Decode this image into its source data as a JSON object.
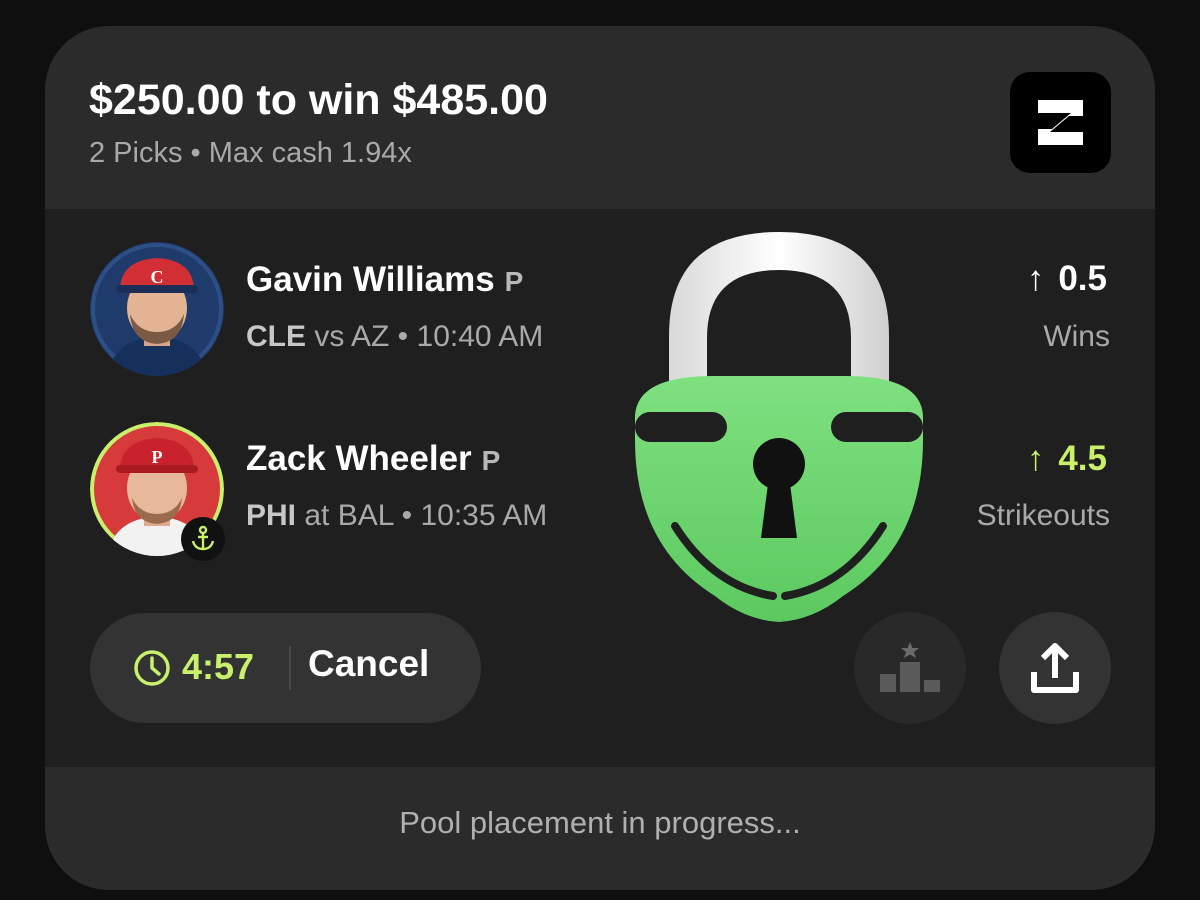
{
  "header": {
    "title": "$250.00 to win $485.00",
    "subtitle": "2 Picks • Max cash 1.94x",
    "brand_icon": "brand-logo-icon"
  },
  "picks": [
    {
      "name": "Gavin Williams",
      "position": "P",
      "team": "CLE",
      "matchup_rest": " vs AZ • 10:40 AM",
      "line": "0.5",
      "stat": "Wins",
      "direction": "up-arrow-icon",
      "line_color": "#ffffff"
    },
    {
      "name": "Zack Wheeler",
      "position": "P",
      "team": "PHI",
      "matchup_rest": " at BAL • 10:35 AM",
      "line": "4.5",
      "stat": "Strikeouts",
      "direction": "up-arrow-icon",
      "line_color": "#c8f06a",
      "badge_icon": "anchor-icon"
    }
  ],
  "overlay_icon": "padlock-icon",
  "actions": {
    "timer": "4:57",
    "cancel_label": "Cancel",
    "leaderboard_icon": "podium-icon",
    "share_icon": "share-icon"
  },
  "footer": {
    "status": "Pool placement in progress..."
  },
  "colors": {
    "accent": "#c8f06a",
    "lock_green": "#6fd672",
    "card_bg": "#1f1f1f",
    "header_bg": "#2b2b2b"
  }
}
